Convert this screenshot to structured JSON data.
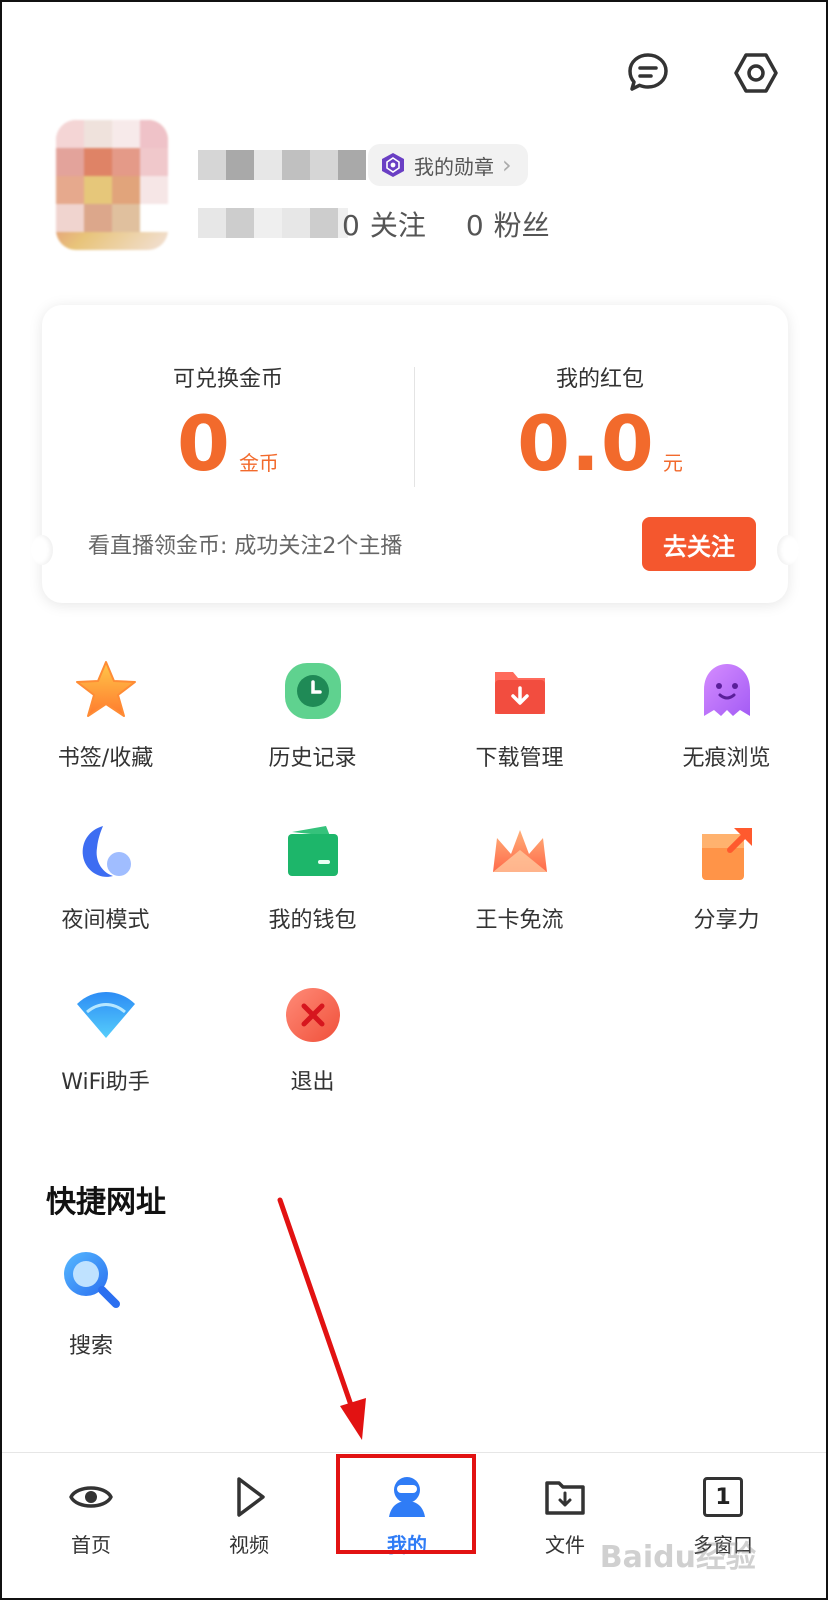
{
  "header": {
    "message_icon": "chat-bubble-icon",
    "settings_icon": "settings-hex-icon"
  },
  "profile": {
    "badge_label": "我的勋章",
    "following_count": "0",
    "following_label": "关注",
    "followers_count": "0",
    "followers_label": "粉丝"
  },
  "wallet": {
    "coins_label": "可兑换金币",
    "coins_value": "0",
    "coins_unit": "金币",
    "redpacket_label": "我的红包",
    "redpacket_value": "0.0",
    "redpacket_unit": "元",
    "task_text": "看直播领金币: 成功关注2个主播",
    "task_button": "去关注"
  },
  "tools": [
    {
      "label": "书签/收藏",
      "icon": "star-icon"
    },
    {
      "label": "历史记录",
      "icon": "clock-icon"
    },
    {
      "label": "下载管理",
      "icon": "download-folder-icon"
    },
    {
      "label": "无痕浏览",
      "icon": "ghost-icon"
    },
    {
      "label": "夜间模式",
      "icon": "moon-icon"
    },
    {
      "label": "我的钱包",
      "icon": "wallet-icon"
    },
    {
      "label": "王卡免流",
      "icon": "crown-icon"
    },
    {
      "label": "分享力",
      "icon": "share-icon"
    },
    {
      "label": "WiFi助手",
      "icon": "wifi-icon"
    },
    {
      "label": "退出",
      "icon": "exit-icon"
    }
  ],
  "quick_links": {
    "title": "快捷网址",
    "items": [
      {
        "label": "搜索",
        "icon": "search-icon"
      }
    ]
  },
  "bottom_nav": {
    "items": [
      {
        "label": "首页",
        "icon": "eye-icon"
      },
      {
        "label": "视频",
        "icon": "play-icon"
      },
      {
        "label": "我的",
        "icon": "person-icon",
        "active": true
      },
      {
        "label": "文件",
        "icon": "file-download-icon"
      },
      {
        "label": "多窗口",
        "icon": "window-count-icon",
        "count": "1"
      }
    ]
  },
  "colors": {
    "accent_orange": "#f26a2c",
    "button_red": "#f4572e",
    "active_blue": "#2f7cf6",
    "annotation_red": "#e21212"
  },
  "watermark": "Baidu经验"
}
